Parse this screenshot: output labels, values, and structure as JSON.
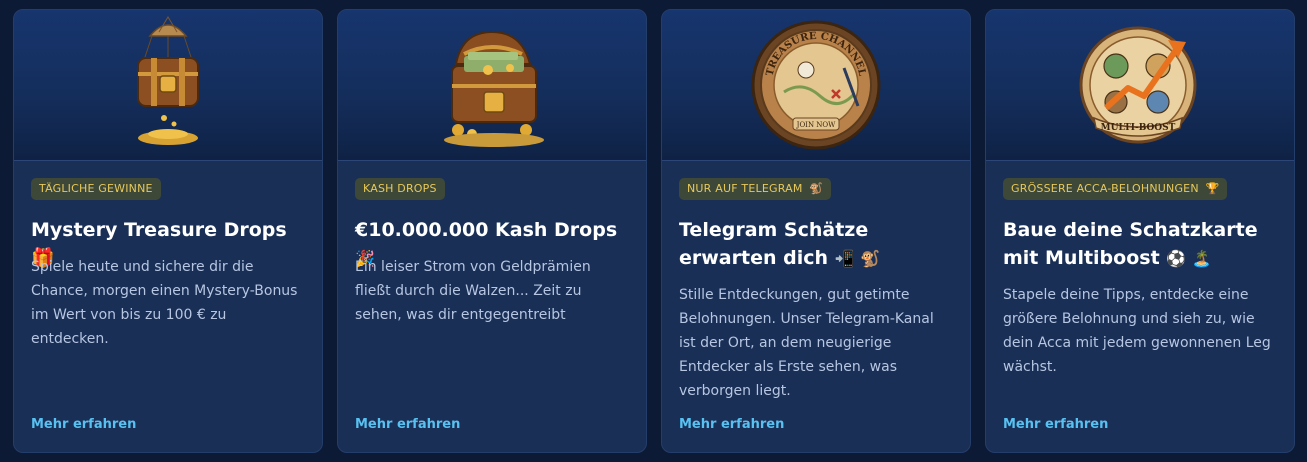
{
  "cards": [
    {
      "image_icon": "treasure-chest-parachute",
      "badge": "TÄGLICHE GEWINNE",
      "badge_emoji": "",
      "title": "Mystery Treasure Drops",
      "title_emoji": "🎁",
      "description": "Spiele heute und sichere dir die Chance, morgen einen Mystery-Bonus im Wert von bis zu 100 € zu entdecken.",
      "link": "Mehr erfahren"
    },
    {
      "image_icon": "open-treasure-chest-money",
      "badge": "KASH DROPS",
      "badge_emoji": "",
      "title": "€10.000.000 Kash Drops",
      "title_emoji": "🎉",
      "description": "Ein leiser Strom von Geldprämien fließt durch die Walzen... Zeit zu sehen, was dir entgegentreibt",
      "link": "Mehr erfahren"
    },
    {
      "image_icon": "treasure-channel-seal",
      "badge": "NUR AUF TELEGRAM",
      "badge_emoji": "🐒",
      "title": "Telegram Schätze erwarten dich",
      "title_emoji": "📲 🐒",
      "description": "Stille Entdeckungen, gut getimte Belohnungen. Unser Telegram-Kanal ist der Ort, an dem neugierige Entdecker als Erste sehen, was verborgen liegt.",
      "link": "Mehr erfahren"
    },
    {
      "image_icon": "multi-boost-seal",
      "badge": "GRÖSSERE ACCA-BELOHNUNGEN",
      "badge_emoji": "🏆",
      "title": "Baue deine Schatzkarte mit Multiboost",
      "title_emoji": "⚽ 🏝️",
      "description": "Stapele deine Tipps, entdecke eine größere Belohnung und sieh zu, wie dein Acca mit jedem gewonnenen Leg wächst.",
      "link": "Mehr erfahren"
    }
  ],
  "seal_text": {
    "treasure_channel": "TREASURE CHANNEL",
    "join_now": "JOIN NOW",
    "multi_boost": "MULTI-BOOST"
  }
}
